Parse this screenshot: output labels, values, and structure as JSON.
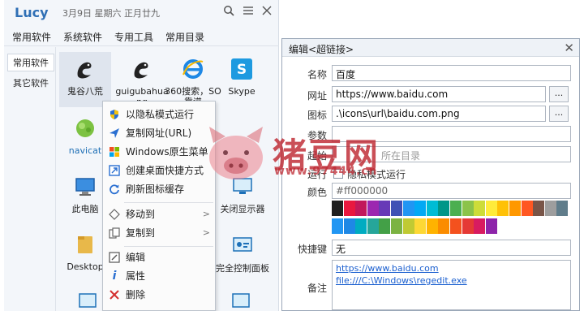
{
  "launcher": {
    "title": "Lucy",
    "date": "3月9日 星期六 正月廿九",
    "menu": [
      "常用软件",
      "系统软件",
      "专用工具",
      "常用目录"
    ],
    "sidebar": [
      "常用软件",
      "其它软件"
    ],
    "apps": [
      {
        "label": "鬼谷八荒",
        "icon": "dragon-icon"
      },
      {
        "label": "guigubahuang",
        "icon": "dragon-icon"
      },
      {
        "label": "360搜索，SO靠谱",
        "icon": "ie-icon"
      },
      {
        "label": "Skype",
        "icon": "skype-icon"
      },
      {
        "label": "navicat",
        "icon": "navicat-icon"
      },
      {
        "label": "此电脑",
        "icon": "computer-icon"
      },
      {
        "label": "关闭显示器",
        "icon": "monitor-off-icon"
      },
      {
        "label": "Desktop",
        "icon": "folder-icon"
      },
      {
        "label": "完全控制面板",
        "icon": "control-panel-icon"
      }
    ]
  },
  "context_menu": {
    "items": [
      {
        "label": "以隐私模式运行",
        "icon": "shield-icon"
      },
      {
        "label": "复制网址(URL)",
        "icon": "send-icon"
      },
      {
        "label": "Windows原生菜单",
        "icon": "windows-icon"
      },
      {
        "label": "创建桌面快捷方式",
        "icon": "shortcut-icon"
      },
      {
        "label": "刷新图标缓存",
        "icon": "refresh-icon"
      },
      {
        "label": "移动到",
        "icon": "move-icon",
        "submenu": true
      },
      {
        "label": "复制到",
        "icon": "copy-icon",
        "submenu": true
      },
      {
        "label": "编辑",
        "icon": "edit-icon"
      },
      {
        "label": "属性",
        "icon": "info-icon"
      },
      {
        "label": "删除",
        "icon": "delete-icon"
      }
    ]
  },
  "editor": {
    "title": "编辑<超链接>",
    "labels": {
      "name": "名称",
      "url": "网址",
      "icon": "图标",
      "params": "参数",
      "workdir": "起始",
      "run": "运行",
      "color": "颜色",
      "hotkey": "快捷键",
      "notes": "备注"
    },
    "name": "百度",
    "url": "https://www.baidu.com",
    "icon_path": ".\\icons\\url\\baidu.com.png",
    "browse_label": "...",
    "workdir_placeholder": "所在目录",
    "privacy_checkbox_label": "隐私模式运行",
    "color_value": "#ff000000",
    "hotkey": "无",
    "notes_lines": [
      "https://www.baidu.com",
      "file:///C:\\Windows\\regedit.exe"
    ],
    "palette_row1": [
      "#1f1f1f",
      "#e8183f",
      "#c2185b",
      "#9c27b0",
      "#673ab7",
      "#3f51b5",
      "#2196f3",
      "#03a9f4",
      "#00bcd4",
      "#009688",
      "#4caf50",
      "#8bc34a",
      "#cddc39",
      "#ffeb3b",
      "#ffc107",
      "#ff9800",
      "#ff5722",
      "#795548",
      "#9e9e9e",
      "#607d8b"
    ],
    "palette_row2": [
      "#2196f3",
      "#1e88e5",
      "#00acc1",
      "#26a69a",
      "#43a047",
      "#7cb342",
      "#c0ca33",
      "#fdd835",
      "#ffb300",
      "#fb8c00",
      "#f4511e",
      "#e53935",
      "#d81b60",
      "#8e24aa"
    ]
  },
  "watermark": {
    "text": "猪豆网",
    "url": "www.97444.cn"
  }
}
